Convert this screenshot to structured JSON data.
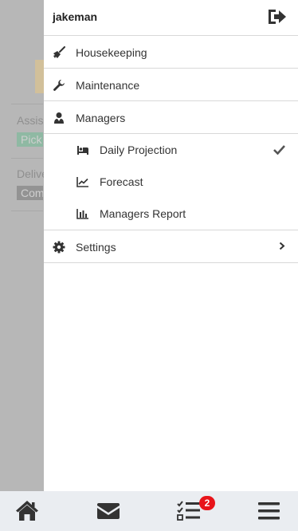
{
  "background": {
    "items": [
      {
        "label": "Assis",
        "badge": "Pick"
      },
      {
        "label": "Delive",
        "badge": "Com"
      }
    ]
  },
  "drawer": {
    "username": "jakeman",
    "menu": [
      {
        "label": "Housekeeping",
        "icon": "broom-icon"
      },
      {
        "label": "Maintenance",
        "icon": "wrench-icon"
      },
      {
        "label": "Managers",
        "icon": "user-tie-icon"
      }
    ],
    "managers_submenu": [
      {
        "label": "Daily Projection",
        "icon": "bed-icon",
        "selected": true
      },
      {
        "label": "Forecast",
        "icon": "line-chart-icon"
      },
      {
        "label": "Managers Report",
        "icon": "bar-chart-icon"
      }
    ],
    "settings": {
      "label": "Settings",
      "icon": "gear-icon"
    }
  },
  "bottom_nav": {
    "items": [
      "home-icon",
      "envelope-icon",
      "tasks-icon",
      "hamburger-menu-icon"
    ],
    "tasks_badge": "2"
  },
  "colors": {
    "badge": "#e8141a",
    "nav_bg": "#eaedf1",
    "icon": "#333333"
  }
}
